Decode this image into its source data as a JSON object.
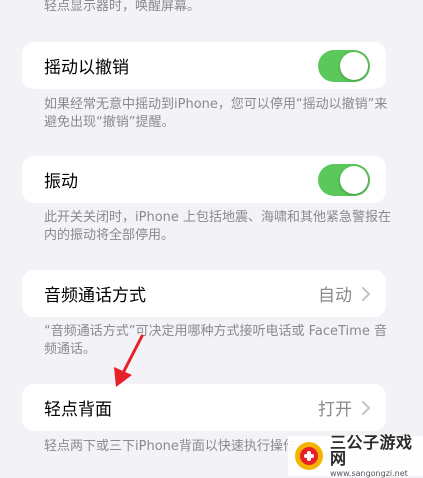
{
  "top_note": "轻点显示器时，唤醒屏幕。",
  "shake_undo": {
    "label": "摇动以撤销",
    "on": true,
    "note": "如果经常无意中摇动到iPhone，您可以停用“摇动以撤销”来避免出现“撤销”提醒。"
  },
  "vibration": {
    "label": "振动",
    "on": true,
    "note": "此开关关闭时，iPhone 上包括地震、海啸和其他紧急警报在内的振动将全部停用。"
  },
  "call_audio": {
    "label": "音频通话方式",
    "value": "自动",
    "note": "“音频通话方式”可决定用哪种方式接听电话或 FaceTime 音频通话。"
  },
  "back_tap": {
    "label": "轻点背面",
    "value": "打开",
    "note": "轻点两下或三下iPhone背面以快速执行操作。"
  },
  "annotation": {
    "arrow_color": "#e8202a"
  },
  "watermark": {
    "title": "三公子游戏网",
    "url": "www.sangongzi.net"
  },
  "colors": {
    "toggle_on": "#5ac85a",
    "background": "#f2f2f7"
  }
}
